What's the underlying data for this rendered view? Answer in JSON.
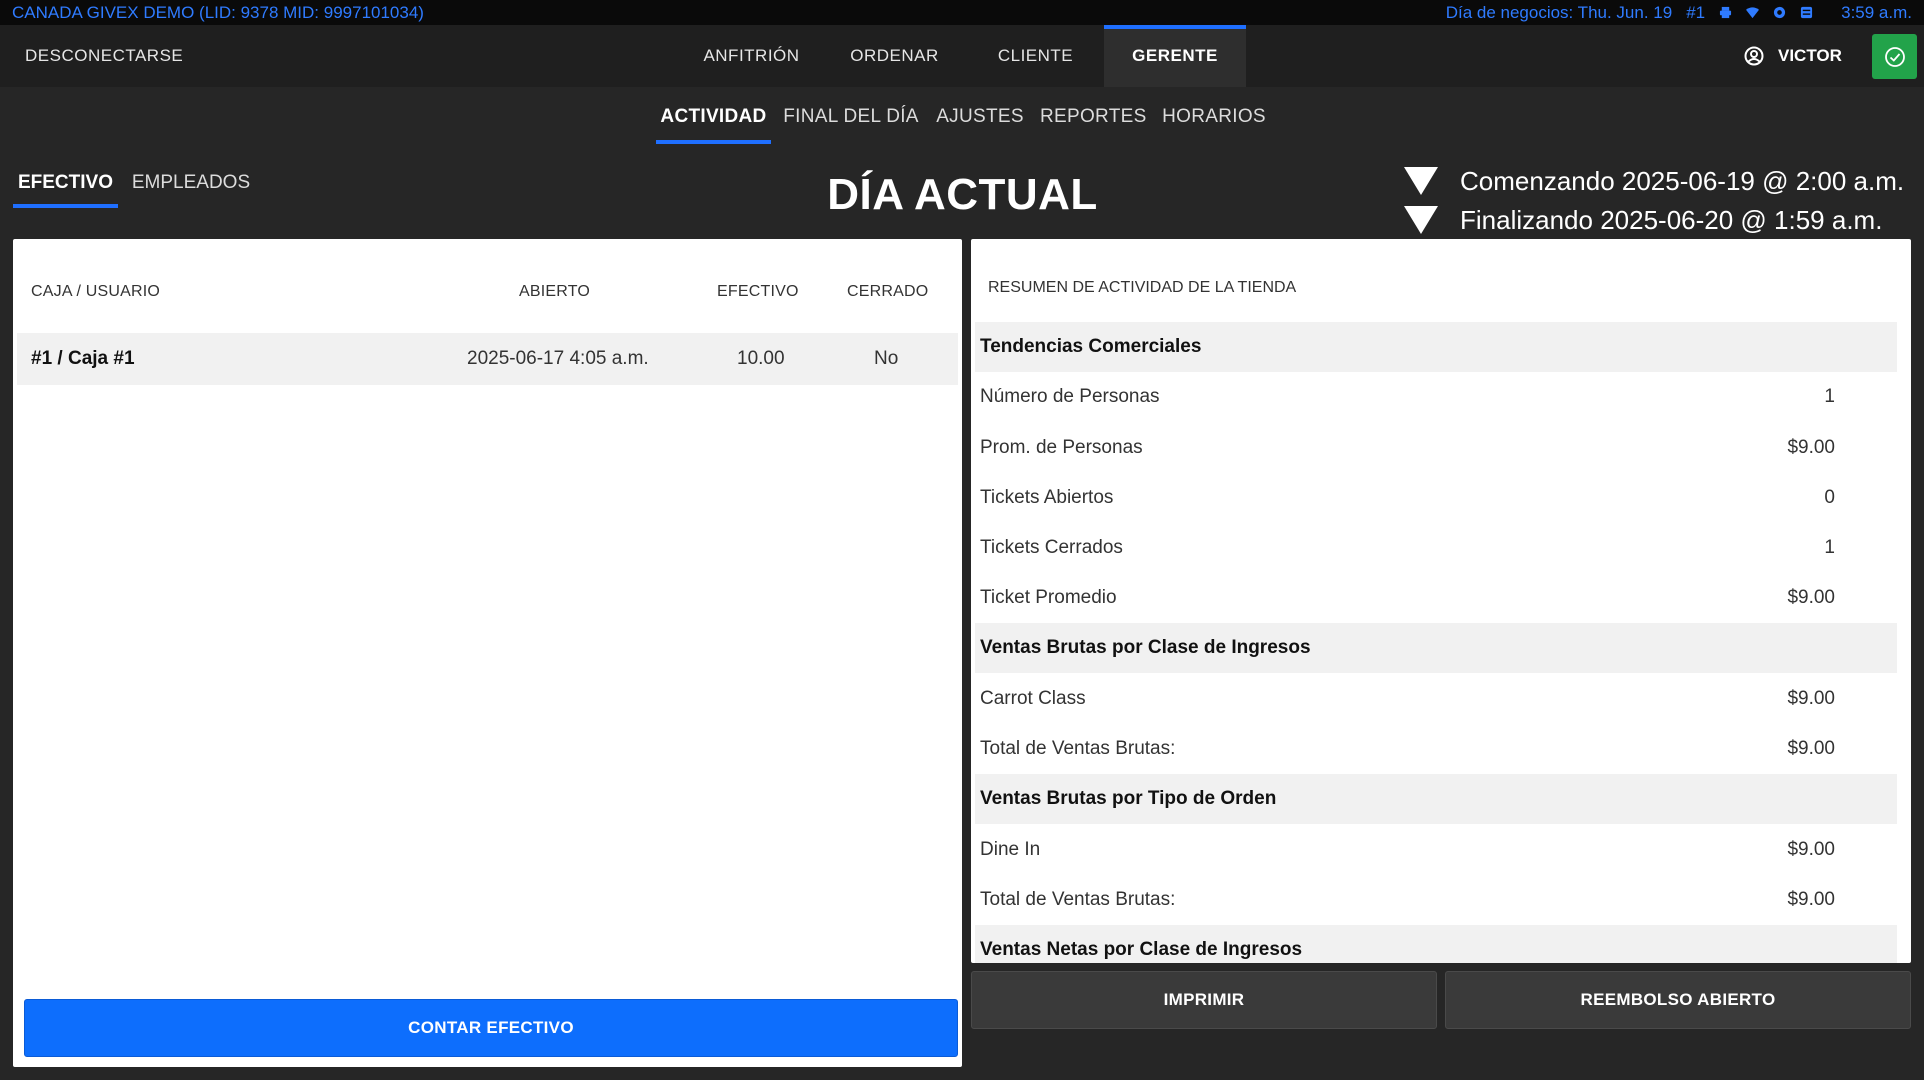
{
  "status_bar": {
    "left": "CANADA GIVEX DEMO (LID: 9378 MID: 9997101034)",
    "business_day": "Día de negocios: Thu. Jun. 19",
    "station": "#1",
    "icons": [
      "printer-icon",
      "wifi-icon",
      "location-icon",
      "database-icon"
    ],
    "time": "3:59 a.m.",
    "color": "#2f7bff"
  },
  "top_nav": {
    "logout": "DESCONECTARSE",
    "tabs": [
      {
        "label": "ANFITRIÓN",
        "active": false
      },
      {
        "label": "ORDENAR",
        "active": false
      },
      {
        "label": "CLIENTE",
        "active": false
      },
      {
        "label": "GERENTE",
        "active": true
      }
    ],
    "user": "VICTOR",
    "accent": "#1f6fff",
    "ok_color": "#22a34a"
  },
  "sub_nav": {
    "tabs": [
      {
        "label": "ACTIVIDAD",
        "active": true
      },
      {
        "label": "FINAL DEL DÍA",
        "active": false
      },
      {
        "label": "AJUSTES",
        "active": false
      },
      {
        "label": "REPORTES",
        "active": false
      },
      {
        "label": "HORARIOS",
        "active": false
      }
    ]
  },
  "section_tabs": [
    {
      "label": "EFECTIVO",
      "active": true
    },
    {
      "label": "EMPLEADOS",
      "active": false
    }
  ],
  "day": {
    "title": "DÍA ACTUAL",
    "start": "Comenzando 2025-06-19 @ 2:00 a.m.",
    "end": "Finalizando 2025-06-20 @ 1:59 a.m."
  },
  "cash_table": {
    "headers": [
      "CAJA / USUARIO",
      "ABIERTO",
      "EFECTIVO",
      "CERRADO"
    ],
    "rows": [
      {
        "register": "#1 / Caja #1",
        "opened": "2025-06-17 4:05 a.m.",
        "cash": "10.00",
        "closed": "No"
      }
    ],
    "count_button": "CONTAR EFECTIVO"
  },
  "summary": {
    "title": "RESUMEN DE ACTIVIDAD DE LA TIENDA",
    "rows": [
      {
        "label": "Tendencias Comerciales",
        "value": "",
        "section": true
      },
      {
        "label": "Número de Personas",
        "value": "1",
        "section": false
      },
      {
        "label": "Prom. de Personas",
        "value": "$9.00",
        "section": false
      },
      {
        "label": "Tickets Abiertos",
        "value": "0",
        "section": false
      },
      {
        "label": "Tickets Cerrados",
        "value": "1",
        "section": false
      },
      {
        "label": "Ticket Promedio",
        "value": "$9.00",
        "section": false
      },
      {
        "label": "Ventas Brutas por Clase de Ingresos",
        "value": "",
        "section": true
      },
      {
        "label": "Carrot Class",
        "value": "$9.00",
        "section": false
      },
      {
        "label": "Total de Ventas Brutas:",
        "value": "$9.00",
        "section": false
      },
      {
        "label": "Ventas Brutas por Tipo de Orden",
        "value": "",
        "section": true
      },
      {
        "label": "Dine In",
        "value": "$9.00",
        "section": false
      },
      {
        "label": "Total de Ventas Brutas:",
        "value": "$9.00",
        "section": false
      },
      {
        "label": "Ventas Netas por Clase de Ingresos",
        "value": "",
        "section": true
      }
    ]
  },
  "buttons": {
    "print": "IMPRIMIR",
    "open_refund": "REEMBOLSO ABIERTO"
  }
}
